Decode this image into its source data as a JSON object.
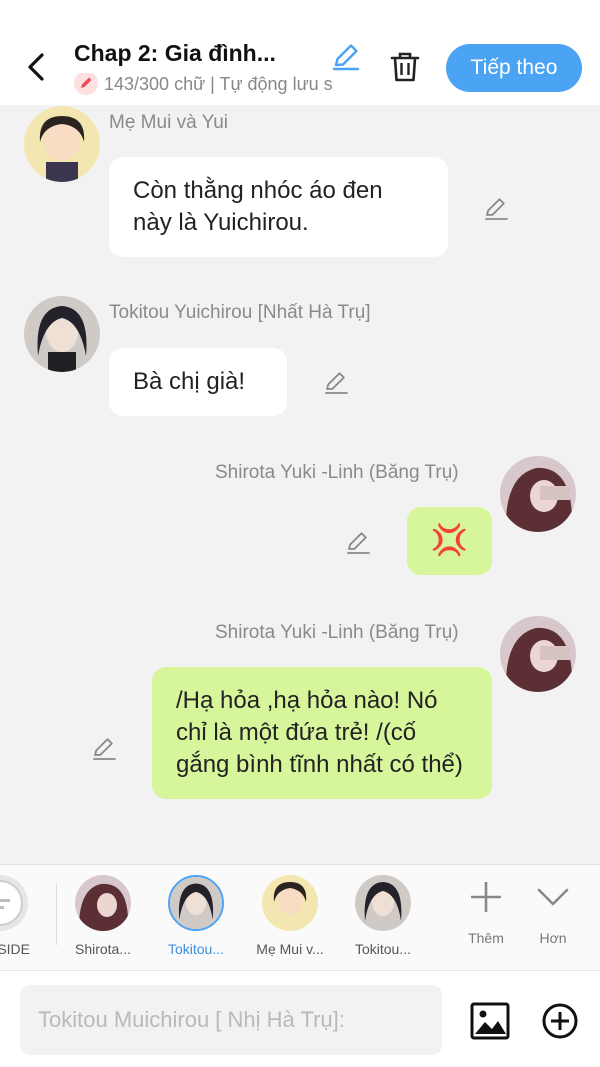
{
  "header": {
    "title": "Chap 2: Gia đình...",
    "subline": "143/300 chữ | Tự động lưu s",
    "next_label": "Tiếp theo"
  },
  "messages": [
    {
      "side": "left",
      "name": "Mẹ Mui và Yui",
      "text": "Còn thằng nhóc áo đen này là Yuichirou."
    },
    {
      "side": "left",
      "name": "Tokitou Yuichirou [Nhất Hà Trụ]",
      "text": "Bà chị già!"
    },
    {
      "side": "right",
      "name": "Shirota Yuki -Linh (Băng Trụ)",
      "emoji": "💢"
    },
    {
      "side": "right",
      "name": "Shirota Yuki -Linh (Băng Trụ)",
      "text": "/Hạ hỏa ,hạ hỏa nào! Nó chỉ là một đứa trẻ! /(cố gắng bình tĩnh nhất có thể)"
    }
  ],
  "charbar": {
    "side_label": "SIDE",
    "items": [
      "Shirota...",
      "Tokitou...",
      "Mẹ Mui v...",
      "Tokitou..."
    ],
    "add_label": "Thêm",
    "more_label": "Hơn"
  },
  "composer": {
    "placeholder": "Tokitou Muichirou [ Nhị Hà Trụ]:"
  },
  "colors": {
    "accent": "#4aa3f3",
    "right_bubble": "#d7f59a",
    "left_bubble": "#ffffff",
    "background": "#f2f2f2"
  }
}
